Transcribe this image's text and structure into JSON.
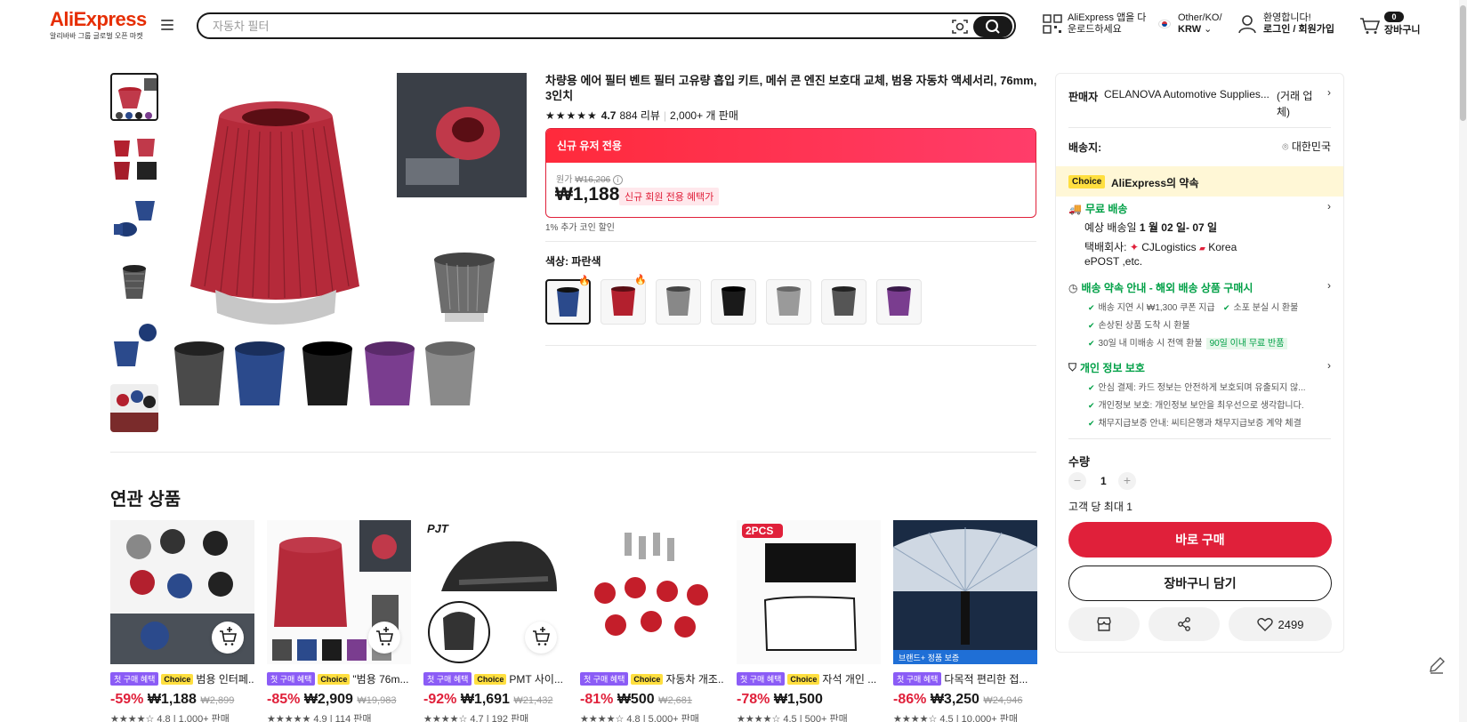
{
  "header": {
    "logo_text": "AliExpress",
    "logo_tagline": "알리바바 그룹 글로벌 오픈 마켓",
    "search_placeholder": "자동차 필터",
    "app_line1": "AliExpress 앱을 다",
    "app_line2": "운로드하세요",
    "region_line1": "Other/KO/",
    "region_line2": "KRW",
    "account_line1": "환영합니다!",
    "account_line2": "로그인 / 회원가입",
    "cart_count": "0",
    "cart_label": "장바구니"
  },
  "product": {
    "title": "차량용 에어 필터 벤트 필터 고유량 흡입 키트, 메쉬 콘 엔진 보호대 교체, 범용 자동차 액세서리, 76mm, 3인치",
    "rating": "4.7",
    "reviews": "884 리뷰",
    "sold": "2,000+ 개 판매",
    "promo_header": "신규 유저 전용",
    "original_label": "원가",
    "original_price": "₩16,206",
    "price": "₩1,188",
    "promo_tag": "신규 회원 전용 혜택가",
    "coin_note": "1% 추가 코인 할인",
    "color_label": "색상: 파란색",
    "swatch_colors": [
      "#2b4a8c",
      "#b3202e",
      "#888888",
      "#1a1a1a",
      "#9a9a9a",
      "#555555",
      "#7a3d8f"
    ]
  },
  "related": {
    "title": "연관 상품",
    "first_badge": "첫 구매 혜택",
    "choice_badge": "Choice",
    "items": [
      {
        "name": "범용 인터페...",
        "discount": "-59%",
        "price": "₩1,188",
        "original": "₩2,899",
        "rating": "4.8",
        "sold": "1,000+ 판매"
      },
      {
        "name": "\"범용 76m...",
        "discount": "-85%",
        "price": "₩2,909",
        "original": "₩19,983",
        "rating": "4.9",
        "sold": "114 판매"
      },
      {
        "name": "PMT 사이...",
        "discount": "-92%",
        "price": "₩1,691",
        "original": "₩21,432",
        "rating": "4.7",
        "sold": "192 판매"
      },
      {
        "name": "자동차 개조...",
        "discount": "-81%",
        "price": "₩500",
        "original": "₩2,681",
        "rating": "4.8",
        "sold": "5,000+ 판매"
      },
      {
        "name": "자석 개인 ...",
        "discount": "-78%",
        "price": "₩1,500",
        "original": "",
        "rating": "4.5",
        "sold": "500+ 판매"
      },
      {
        "name": "다목적 편리한 접...",
        "discount": "-86%",
        "price": "₩3,250",
        "original": "₩24,946",
        "rating": "4.5",
        "sold": "10,000+ 판매"
      }
    ],
    "tag_2pcs": "2PCS",
    "tag_brand": "브랜드+ 정품 보증",
    "tag_pjt": "PJT"
  },
  "panel": {
    "seller_label": "판매자",
    "seller_name": "CELANOVA Automotive Supplies...",
    "seller_suffix": "(거래 업체)",
    "ship_to_label": "배송지:",
    "ship_to_value": "대한민국",
    "choice_chip": "Choice",
    "choice_promise": "AliExpress의 약속",
    "free_ship": "무료 배송",
    "eta_prefix": "예상 배송일",
    "eta_value": "1 월 02 일- 07 일",
    "carrier_label": "택배회사:",
    "carrier_1": "CJLogistics",
    "carrier_2": "Korea",
    "carrier_3": "ePOST ,etc.",
    "guarantee_title": "배송 약속 안내 - 해외 배송 상품 구매시",
    "g1": "배송 지연 시 ₩1,300 쿠폰 지급",
    "g2": "소포 분실 시 환불",
    "g3": "손상된 상품 도착 시 환불",
    "g4": "30일 내 미배송 시 전액 환불",
    "g4_tag": "90일 이내 무료 반품",
    "privacy_title": "개인 정보 보호",
    "p1": "안심 결제: 카드 정보는 안전하게 보호되며 유출되지 않...",
    "p2": "개인정보 보호: 개인정보 보안을 최우선으로 생각합니다.",
    "p3": "채무지급보증 안내: 씨티은행과 채무지급보증 계약 체결",
    "qty_label": "수량",
    "qty_value": "1",
    "qty_max": "고객 당 최대 1",
    "buy_now": "바로 구매",
    "add_cart": "장바구니 담기",
    "wish_count": "2499"
  },
  "colors": {
    "accent_red": "#e0203a",
    "brand_red": "#e62e04",
    "choice_yellow": "#ffdf3f",
    "green": "#00a046"
  }
}
